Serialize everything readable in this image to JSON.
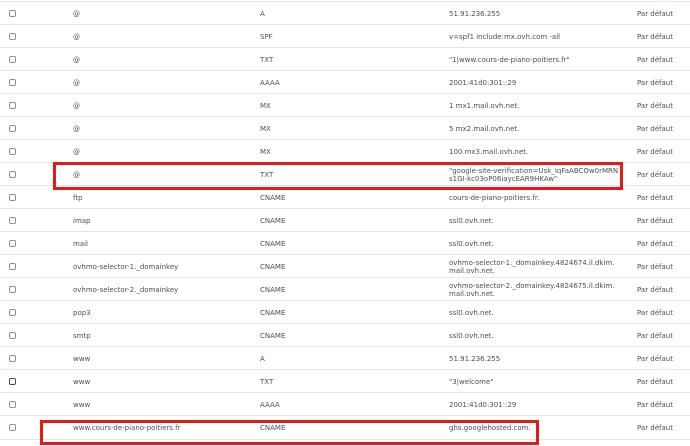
{
  "rows": [
    {
      "domain": "@",
      "type": "A",
      "target": "51.91.236.255",
      "ttl": "Par défaut"
    },
    {
      "domain": "@",
      "type": "SPF",
      "target": "v=spf1 include:mx.ovh.com -all",
      "ttl": "Par défaut"
    },
    {
      "domain": "@",
      "type": "TXT",
      "target": "\"1|www.cours-de-piano-poitiers.fr\"",
      "ttl": "Par défaut"
    },
    {
      "domain": "@",
      "type": "AAAA",
      "target": "2001:41d0:301::29",
      "ttl": "Par défaut"
    },
    {
      "domain": "@",
      "type": "MX",
      "target": "1 mx1.mail.ovh.net.",
      "ttl": "Par défaut"
    },
    {
      "domain": "@",
      "type": "MX",
      "target": "5 mx2.mail.ovh.net.",
      "ttl": "Par défaut"
    },
    {
      "domain": "@",
      "type": "MX",
      "target": "100 mx3.mail.ovh.net.",
      "ttl": "Par défaut"
    },
    {
      "domain": "@",
      "type": "TXT",
      "target": "\"google-site-verification=Usk_IqFaABCOw0rMRNs1GI-kc03oP06iaycEAR9HKAw\"",
      "ttl": "Par défaut"
    },
    {
      "domain": "ftp",
      "type": "CNAME",
      "target": "cours-de-piano-poitiers.fr.",
      "ttl": "Par défaut"
    },
    {
      "domain": "imap",
      "type": "CNAME",
      "target": "ssl0.ovh.net.",
      "ttl": "Par défaut"
    },
    {
      "domain": "mail",
      "type": "CNAME",
      "target": "ssl0.ovh.net.",
      "ttl": "Par défaut"
    },
    {
      "domain": "ovhmo-selector-1._domainkey",
      "type": "CNAME",
      "target": "ovhmo-selector-1._domainkey.4824674.il.dkim.mail.ovh.net.",
      "ttl": "Par défaut"
    },
    {
      "domain": "ovhmo-selector-2._domainkey",
      "type": "CNAME",
      "target": "ovhmo-selector-2._domainkey.4824675.il.dkim.mail.ovh.net.",
      "ttl": "Par défaut"
    },
    {
      "domain": "pop3",
      "type": "CNAME",
      "target": "ssl0.ovh.net.",
      "ttl": "Par défaut"
    },
    {
      "domain": "smtp",
      "type": "CNAME",
      "target": "ssl0.ovh.net.",
      "ttl": "Par défaut"
    },
    {
      "domain": "www",
      "type": "A",
      "target": "51.91.236.255",
      "ttl": "Par défaut"
    },
    {
      "domain": "www",
      "type": "TXT",
      "target": "\"3|welcome\"",
      "ttl": "Par défaut"
    },
    {
      "domain": "www",
      "type": "AAAA",
      "target": "2001:41d0:301::29",
      "ttl": "Par défaut"
    },
    {
      "domain": "www.cours-de-piano-poitiers.fr",
      "type": "CNAME",
      "target": "ghs.googlehosted.com.",
      "ttl": "Par défaut"
    }
  ],
  "colors": {
    "highlight": "#e21b1b",
    "text": "#4a4f5a",
    "row_border": "#e3e6ea"
  }
}
